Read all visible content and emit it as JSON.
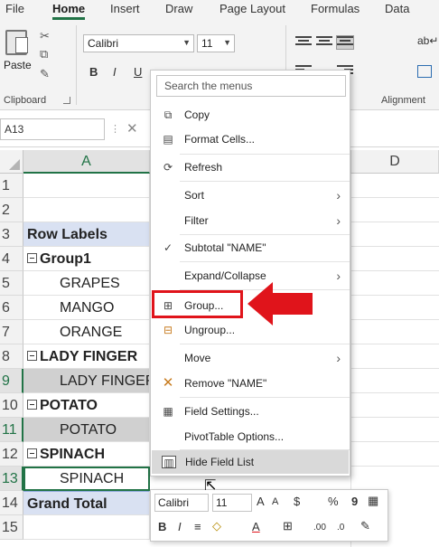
{
  "ribbon_tabs": [
    "File",
    "Home",
    "Insert",
    "Draw",
    "Page Layout",
    "Formulas",
    "Data"
  ],
  "ribbon": {
    "paste_label": "Paste",
    "clipboard_label": "Clipboard",
    "alignment_label": "Alignment",
    "font_name": "Calibri",
    "font_size": "11",
    "bold": "B",
    "italic": "I",
    "underline": "U"
  },
  "formula_bar": {
    "name_box": "A13",
    "cancel_glyph": "✕"
  },
  "columns": [
    "A",
    "D"
  ],
  "rows": [
    "1",
    "2",
    "3",
    "4",
    "5",
    "6",
    "7",
    "8",
    "9",
    "10",
    "11",
    "12",
    "13",
    "14",
    "15"
  ],
  "cells": {
    "r3": "Row Labels",
    "r4": "Group1",
    "r5": "GRAPES",
    "r6": "MANGO",
    "r7": "ORANGE",
    "r8": "LADY FINGER",
    "r9": "LADY FINGER",
    "r10": "POTATO",
    "r11": "POTATO",
    "r12": "SPINACH",
    "r13": "SPINACH",
    "r14": "Grand Total"
  },
  "context_menu": {
    "search_placeholder": "Search the menus",
    "items": [
      {
        "label": "Copy",
        "icon": "copy-icon"
      },
      {
        "label": "Format Cells...",
        "icon": "format-cells-icon"
      },
      {
        "label": "Refresh",
        "icon": "refresh-icon"
      },
      {
        "label": "Sort",
        "icon": "",
        "submenu": true
      },
      {
        "label": "Filter",
        "icon": "",
        "submenu": true
      },
      {
        "label": "Subtotal \"NAME\"",
        "icon": "checkmark-icon",
        "checked": true
      },
      {
        "label": "Expand/Collapse",
        "icon": "",
        "submenu": true
      },
      {
        "label": "Group...",
        "icon": "group-icon",
        "highlighted": true
      },
      {
        "label": "Ungroup...",
        "icon": "ungroup-icon"
      },
      {
        "label": "Move",
        "icon": "",
        "submenu": true
      },
      {
        "label": "Remove \"NAME\"",
        "icon": "remove-x-icon"
      },
      {
        "label": "Field Settings...",
        "icon": "field-settings-icon"
      },
      {
        "label": "PivotTable Options...",
        "icon": ""
      },
      {
        "label": "Hide Field List",
        "icon": "field-list-icon"
      }
    ]
  },
  "mini_toolbar": {
    "font_name": "Calibri",
    "font_size": "11",
    "bold": "B",
    "italic": "I",
    "currency": "$",
    "percent": "%",
    "comma": "9",
    "inc_font": "A",
    "dec_font": "A",
    "font_color": "A",
    "dec_up": ".00",
    "dec_down": ".0"
  },
  "colors": {
    "accent_green": "#217346",
    "pivot_header": "#d9e1f2",
    "highlight_red": "#e0141b"
  }
}
